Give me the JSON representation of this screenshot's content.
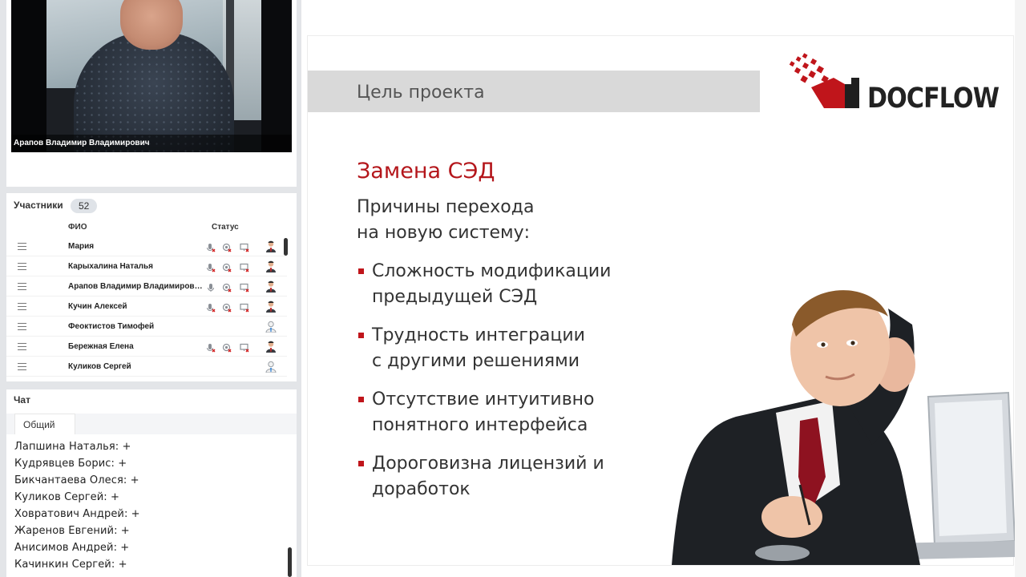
{
  "video": {
    "speaker_name": "Арапов Владимир Владимирович"
  },
  "participants": {
    "title": "Участники",
    "count": "52",
    "col_name": "ФИО",
    "col_status": "Статус",
    "rows": [
      {
        "name": "Мария",
        "muted": true,
        "status_icons": true,
        "role": "presenter"
      },
      {
        "name": "Карыхалина Наталья",
        "muted": true,
        "status_icons": true,
        "role": "presenter"
      },
      {
        "name": "Арапов Владимир Владимиров…",
        "muted": false,
        "status_icons": true,
        "role": "presenter"
      },
      {
        "name": "Кучин Алексей",
        "muted": true,
        "status_icons": true,
        "role": "presenter"
      },
      {
        "name": "Феоктистов Тимофей",
        "muted": true,
        "status_icons": false,
        "role": "listener"
      },
      {
        "name": "Бережная Елена",
        "muted": true,
        "status_icons": true,
        "role": "presenter"
      },
      {
        "name": "Куликов Сергей",
        "muted": true,
        "status_icons": false,
        "role": "listener"
      }
    ]
  },
  "chat": {
    "title": "Чат",
    "tab_label": "Общий",
    "messages": [
      "Лапшина Наталья: +",
      "Кудрявцев Борис: +",
      "Бикчантаева Олеся: +",
      "Куликов Сергей: +",
      "Ховратович Андрей: +",
      "Жаренов Евгений: +",
      "Анисимов Андрей: +",
      "Качинкин Сергей: +"
    ]
  },
  "slide": {
    "title": "Цель проекта",
    "logo_text": "DOCFLOW",
    "heading": "Замена СЭД",
    "subtext_line1": "Причины перехода",
    "subtext_line2": "на новую систему:",
    "bullets": [
      {
        "line1": "Сложность модификации",
        "line2": "предыдущей СЭД"
      },
      {
        "line1": "Трудность интеграции",
        "line2": "с другими решениями"
      },
      {
        "line1": "Отсутствие интуитивно",
        "line2": "понятного интерфейса"
      },
      {
        "line1": "Дороговизна лицензий и",
        "line2": "доработок"
      }
    ]
  },
  "colors": {
    "accent_red": "#b4161b",
    "title_bar_gray": "#d9d9d9",
    "panel_bg": "#e3e5e8"
  }
}
